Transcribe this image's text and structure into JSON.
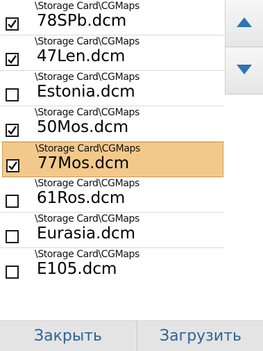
{
  "files": [
    {
      "path": "\\Storage Card\\CGMaps",
      "name": "78SPb.dcm",
      "checked": true,
      "selected": false
    },
    {
      "path": "\\Storage Card\\CGMaps",
      "name": "47Len.dcm",
      "checked": true,
      "selected": false
    },
    {
      "path": "\\Storage Card\\CGMaps",
      "name": "Estonia.dcm",
      "checked": false,
      "selected": false
    },
    {
      "path": "\\Storage Card\\CGMaps",
      "name": "50Mos.dcm",
      "checked": true,
      "selected": false
    },
    {
      "path": "\\Storage Card\\CGMaps",
      "name": "77Mos.dcm",
      "checked": true,
      "selected": true
    },
    {
      "path": "\\Storage Card\\CGMaps",
      "name": "61Ros.dcm",
      "checked": false,
      "selected": false
    },
    {
      "path": "\\Storage Card\\CGMaps",
      "name": "Eurasia.dcm",
      "checked": false,
      "selected": false
    },
    {
      "path": "\\Storage Card\\CGMaps",
      "name": "E105.dcm",
      "checked": false,
      "selected": false
    }
  ],
  "buttons": {
    "close_label": "Закрыть",
    "load_label": "Загрузить"
  },
  "icons": {
    "scroll_up": "triangle-up-icon",
    "scroll_down": "triangle-down-icon",
    "checkbox": "checkmark-icon"
  },
  "colors": {
    "selected_row": "#f3c98b",
    "arrow": "#2d73b8",
    "button_text": "#2f6396"
  }
}
